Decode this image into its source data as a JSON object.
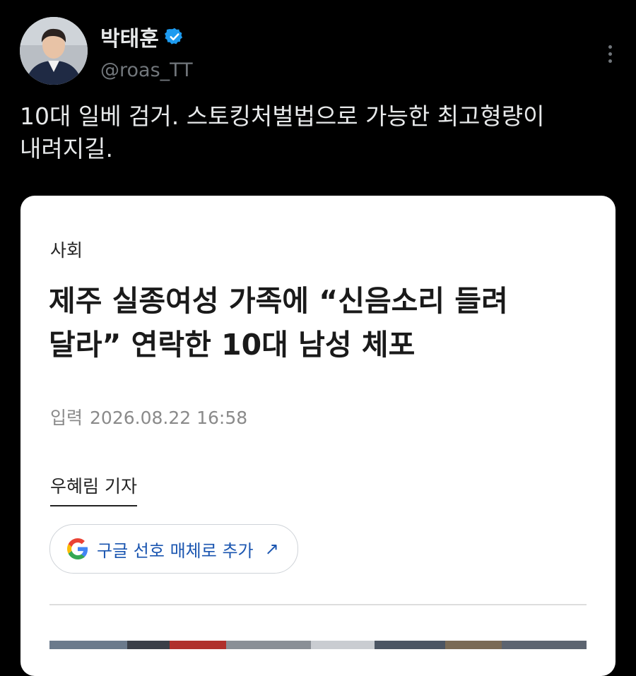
{
  "author": {
    "name": "박태훈",
    "handle": "@roas_TT",
    "verified_color": "#1d9bf0"
  },
  "tweet": {
    "text_line1": "10대 일베 검거. 스토킹처벌법으로 가능한 최고형량이",
    "text_line2": "내려지길."
  },
  "article": {
    "category": "사회",
    "headline_line1": "제주 실종여성 가족에 “신음소리 들려",
    "headline_line2": "달라” 연락한 10대 남성 체포",
    "date_label": "입력",
    "date_value": "2026.08.22 16:58",
    "reporter": "우혜림 기자",
    "google_button_label": "구글 선호 매체로 추가",
    "google_button_arrow": "↗"
  },
  "icons": {
    "verified": "verified-badge-icon",
    "more": "more-vertical-icon",
    "google": "google-g-icon"
  }
}
